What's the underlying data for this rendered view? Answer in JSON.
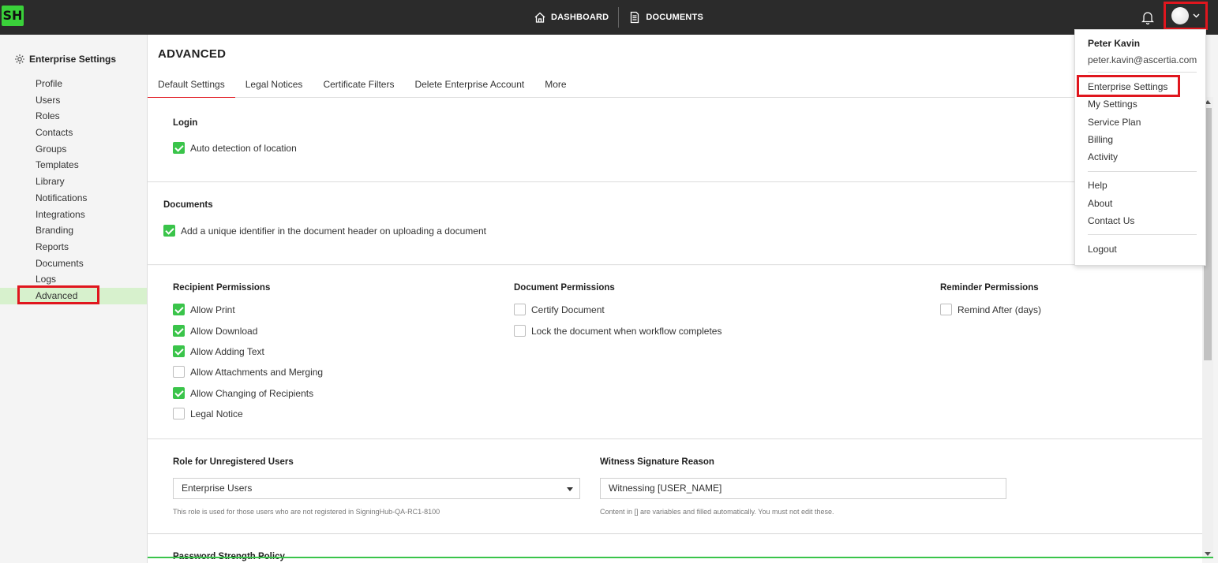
{
  "app": {
    "logo_text": "SH",
    "accent": "#3ac44a",
    "highlight": "#e0161e"
  },
  "topnav": {
    "dashboard": {
      "label": "DASHBOARD",
      "icon": "home-icon"
    },
    "documents": {
      "label": "DOCUMENTS",
      "icon": "document-icon"
    },
    "bell_icon": "bell-icon",
    "avatar_icon": "avatar-icon"
  },
  "sidebar": {
    "title": "Enterprise Settings",
    "title_icon": "gear-icon",
    "items": [
      {
        "label": "Profile"
      },
      {
        "label": "Users"
      },
      {
        "label": "Roles"
      },
      {
        "label": "Contacts"
      },
      {
        "label": "Groups"
      },
      {
        "label": "Templates"
      },
      {
        "label": "Library"
      },
      {
        "label": "Notifications"
      },
      {
        "label": "Integrations"
      },
      {
        "label": "Branding"
      },
      {
        "label": "Reports"
      },
      {
        "label": "Documents"
      },
      {
        "label": "Logs"
      },
      {
        "label": "Advanced",
        "active": true
      }
    ]
  },
  "main": {
    "title": "ADVANCED",
    "tabs": [
      {
        "label": "Default Settings",
        "active": true
      },
      {
        "label": "Legal Notices"
      },
      {
        "label": "Certificate Filters"
      },
      {
        "label": "Delete Enterprise Account"
      },
      {
        "label": "More"
      }
    ],
    "login": {
      "title": "Login",
      "auto_detection": {
        "label": "Auto detection of location",
        "checked": true
      }
    },
    "documents": {
      "title": "Documents",
      "unique_identifier": {
        "label": "Add a unique identifier in the document header on uploading a document",
        "checked": true
      }
    },
    "recipient_permissions": {
      "title": "Recipient Permissions",
      "items": [
        {
          "label": "Allow Print",
          "checked": true
        },
        {
          "label": "Allow Download",
          "checked": true
        },
        {
          "label": "Allow Adding Text",
          "checked": true
        },
        {
          "label": "Allow Attachments and Merging",
          "checked": false
        },
        {
          "label": "Allow Changing of Recipients",
          "checked": true
        },
        {
          "label": "Legal Notice",
          "checked": false
        }
      ]
    },
    "document_permissions": {
      "title": "Document Permissions",
      "items": [
        {
          "label": "Certify Document",
          "checked": false
        },
        {
          "label": "Lock the document when workflow completes",
          "checked": false
        }
      ]
    },
    "reminder_permissions": {
      "title": "Reminder Permissions",
      "items": [
        {
          "label": "Remind After (days)",
          "checked": false
        }
      ]
    },
    "role_unregistered": {
      "title": "Role for Unregistered Users",
      "value": "Enterprise Users",
      "hint": "This role is used for those users who are not registered in SigningHub-QA-RC1-8100"
    },
    "witness_reason": {
      "title": "Witness Signature Reason",
      "value": "Witnessing [USER_NAME]",
      "hint": "Content in [] are variables and filled automatically. You must not edit these."
    },
    "password_policy": {
      "title": "Password Strength Policy"
    }
  },
  "user_menu": {
    "name": "Peter Kavin",
    "email": "peter.kavin@ascertia.com",
    "items_group1": [
      "Enterprise Settings",
      "My Settings",
      "Service Plan",
      "Billing",
      "Activity"
    ],
    "items_group2": [
      "Help",
      "About",
      "Contact Us"
    ],
    "items_group3": [
      "Logout"
    ]
  }
}
